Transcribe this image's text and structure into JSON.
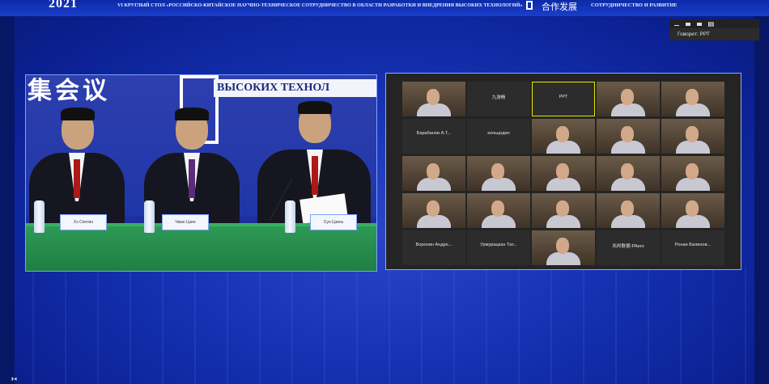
{
  "header": {
    "logo_text": "2021",
    "conference_title": "VI КРУГЛЫЙ СТОЛ «РОССИЙСКО-КИТАЙСКОЕ НАУЧНО-ТЕХНИЧЕСКОЕ СОТРУДНИЧЕСТВО В ОБЛАСТИ РАЗРАБОТКИ И ВНЕДРЕНИЯ ВЫСОКИХ ТЕХНОЛОГИЙ»",
    "cooperation_cn": "合作发展",
    "cooperation_ru": "СОТРУДНИЧЕСТВО И РАЗВИТИЕ"
  },
  "window": {
    "speaking_label": "Говорит: РРТ"
  },
  "venue": {
    "backdrop_cn": "集会议",
    "backdrop_ru": "ВЫСОКИХ ТЕХНОЛ",
    "nameplates": [
      "Хэ Сянтин",
      "Чжан Цзин",
      "Сун Цзинь"
    ]
  },
  "zoom": {
    "tiles": [
      {
        "label": "",
        "caption": "",
        "video": true
      },
      {
        "label": "九游畅",
        "caption": "",
        "video": false
      },
      {
        "label": "РРТ",
        "caption": "",
        "video": false,
        "active": true
      },
      {
        "label": "",
        "caption": "",
        "video": true
      },
      {
        "label": "",
        "caption": "",
        "video": true
      },
      {
        "label": "Барабанов  А.Т...",
        "caption": "",
        "video": false
      },
      {
        "label": "кольцодин",
        "caption": "",
        "video": false
      },
      {
        "label": "",
        "caption": "",
        "video": true
      },
      {
        "label": "",
        "caption": "",
        "video": true
      },
      {
        "label": "",
        "caption": "",
        "video": true
      },
      {
        "label": "",
        "caption": "",
        "video": true
      },
      {
        "label": "",
        "caption": "",
        "video": true
      },
      {
        "label": "",
        "caption": "",
        "video": true
      },
      {
        "label": "",
        "caption": "",
        "video": true
      },
      {
        "label": "",
        "caption": "",
        "video": true
      },
      {
        "label": "",
        "caption": "",
        "video": true
      },
      {
        "label": "",
        "caption": "",
        "video": true
      },
      {
        "label": "",
        "caption": "",
        "video": true
      },
      {
        "label": "",
        "caption": "",
        "video": true
      },
      {
        "label": "",
        "caption": "",
        "video": true
      },
      {
        "label": "Воронин  Андре...",
        "caption": "",
        "video": false
      },
      {
        "label": "Урмурацкан  Тат...",
        "caption": "",
        "video": false
      },
      {
        "label": "",
        "caption": "",
        "video": true
      },
      {
        "label": "兆邦数据-PAero",
        "caption": "",
        "video": false
      },
      {
        "label": "Ронаи  Балинов...",
        "caption": "",
        "video": false
      }
    ]
  }
}
